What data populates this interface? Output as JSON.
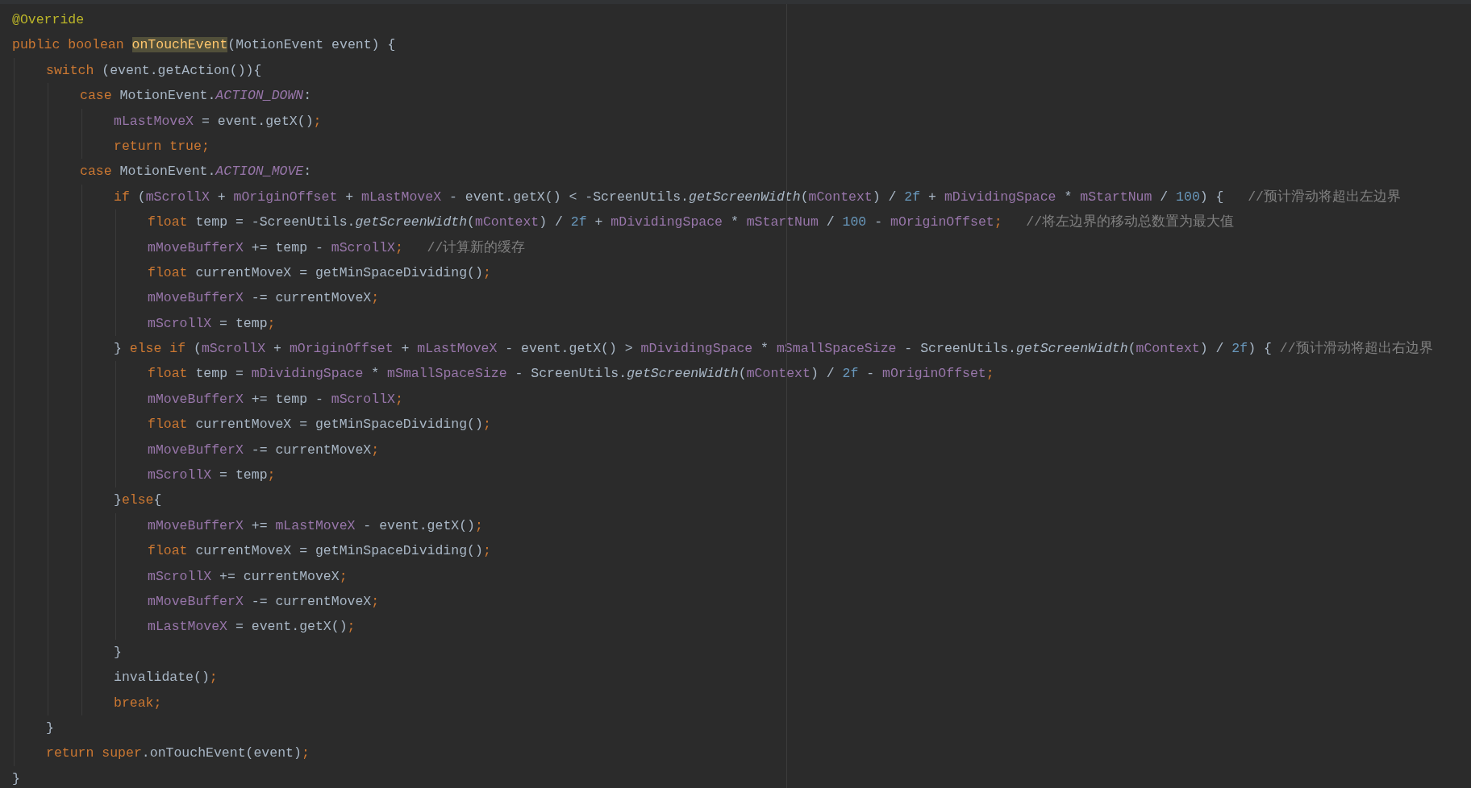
{
  "editor": {
    "lines": [
      {
        "tokens": [
          {
            "kind": "annotation",
            "text": "@Override"
          }
        ]
      },
      {
        "tokens": [
          {
            "kind": "keyword",
            "text": "public boolean "
          },
          {
            "kind": "declaration",
            "text": "onTouchEvent"
          },
          {
            "kind": "plain",
            "text": "(MotionEvent event) {"
          }
        ],
        "children": [
          {
            "tokens": [
              {
                "kind": "keyword",
                "text": "switch "
              },
              {
                "kind": "plain",
                "text": "(event.getAction()){"
              }
            ],
            "children": [
              {
                "tokens": [
                  {
                    "kind": "keyword",
                    "text": "case "
                  },
                  {
                    "kind": "plain",
                    "text": "MotionEvent."
                  },
                  {
                    "kind": "constant",
                    "text": "ACTION_DOWN"
                  },
                  {
                    "kind": "plain",
                    "text": ":"
                  }
                ],
                "children": [
                  {
                    "tokens": [
                      {
                        "kind": "field",
                        "text": "mLastMoveX"
                      },
                      {
                        "kind": "plain",
                        "text": " = event.getX()"
                      },
                      {
                        "kind": "keyword",
                        "text": ";"
                      }
                    ]
                  },
                  {
                    "tokens": [
                      {
                        "kind": "keyword",
                        "text": "return true;"
                      }
                    ]
                  }
                ]
              },
              {
                "tokens": [
                  {
                    "kind": "keyword",
                    "text": "case "
                  },
                  {
                    "kind": "plain",
                    "text": "MotionEvent."
                  },
                  {
                    "kind": "constant",
                    "text": "ACTION_MOVE"
                  },
                  {
                    "kind": "plain",
                    "text": ":"
                  }
                ],
                "children": [
                  {
                    "tokens": [
                      {
                        "kind": "keyword",
                        "text": "if "
                      },
                      {
                        "kind": "plain",
                        "text": "("
                      },
                      {
                        "kind": "field",
                        "text": "mScrollX"
                      },
                      {
                        "kind": "plain",
                        "text": " + "
                      },
                      {
                        "kind": "field",
                        "text": "mOriginOffset"
                      },
                      {
                        "kind": "plain",
                        "text": " + "
                      },
                      {
                        "kind": "field",
                        "text": "mLastMoveX"
                      },
                      {
                        "kind": "plain",
                        "text": " - event.getX() < -ScreenUtils."
                      },
                      {
                        "kind": "static_method",
                        "text": "getScreenWidth"
                      },
                      {
                        "kind": "plain",
                        "text": "("
                      },
                      {
                        "kind": "field",
                        "text": "mContext"
                      },
                      {
                        "kind": "plain",
                        "text": ") / "
                      },
                      {
                        "kind": "number",
                        "text": "2f"
                      },
                      {
                        "kind": "plain",
                        "text": " + "
                      },
                      {
                        "kind": "field",
                        "text": "mDividingSpace"
                      },
                      {
                        "kind": "plain",
                        "text": " * "
                      },
                      {
                        "kind": "field",
                        "text": "mStartNum"
                      },
                      {
                        "kind": "plain",
                        "text": " / "
                      },
                      {
                        "kind": "number",
                        "text": "100"
                      },
                      {
                        "kind": "plain",
                        "text": ") {   "
                      },
                      {
                        "kind": "comment",
                        "text": "//预计滑动将超出左边界"
                      }
                    ],
                    "children": [
                      {
                        "tokens": [
                          {
                            "kind": "keyword",
                            "text": "float "
                          },
                          {
                            "kind": "plain",
                            "text": "temp = -ScreenUtils."
                          },
                          {
                            "kind": "static_method",
                            "text": "getScreenWidth"
                          },
                          {
                            "kind": "plain",
                            "text": "("
                          },
                          {
                            "kind": "field",
                            "text": "mContext"
                          },
                          {
                            "kind": "plain",
                            "text": ") / "
                          },
                          {
                            "kind": "number",
                            "text": "2f"
                          },
                          {
                            "kind": "plain",
                            "text": " + "
                          },
                          {
                            "kind": "field",
                            "text": "mDividingSpace"
                          },
                          {
                            "kind": "plain",
                            "text": " * "
                          },
                          {
                            "kind": "field",
                            "text": "mStartNum"
                          },
                          {
                            "kind": "plain",
                            "text": " / "
                          },
                          {
                            "kind": "number",
                            "text": "100"
                          },
                          {
                            "kind": "plain",
                            "text": " - "
                          },
                          {
                            "kind": "field",
                            "text": "mOriginOffset"
                          },
                          {
                            "kind": "keyword",
                            "text": ";"
                          },
                          {
                            "kind": "comment",
                            "text": "   //将左边界的移动总数置为最大值"
                          }
                        ]
                      },
                      {
                        "tokens": [
                          {
                            "kind": "field",
                            "text": "mMoveBufferX"
                          },
                          {
                            "kind": "plain",
                            "text": " += temp - "
                          },
                          {
                            "kind": "field",
                            "text": "mScrollX"
                          },
                          {
                            "kind": "keyword",
                            "text": ";"
                          },
                          {
                            "kind": "comment",
                            "text": "   //计算新的缓存"
                          }
                        ]
                      },
                      {
                        "tokens": [
                          {
                            "kind": "keyword",
                            "text": "float "
                          },
                          {
                            "kind": "plain",
                            "text": "currentMoveX = getMinSpaceDividing()"
                          },
                          {
                            "kind": "keyword",
                            "text": ";"
                          }
                        ]
                      },
                      {
                        "tokens": [
                          {
                            "kind": "field",
                            "text": "mMoveBufferX"
                          },
                          {
                            "kind": "plain",
                            "text": " -= currentMoveX"
                          },
                          {
                            "kind": "keyword",
                            "text": ";"
                          }
                        ]
                      },
                      {
                        "tokens": [
                          {
                            "kind": "field",
                            "text": "mScrollX"
                          },
                          {
                            "kind": "plain",
                            "text": " = temp"
                          },
                          {
                            "kind": "keyword",
                            "text": ";"
                          }
                        ]
                      }
                    ]
                  },
                  {
                    "tokens": [
                      {
                        "kind": "plain",
                        "text": "} "
                      },
                      {
                        "kind": "keyword",
                        "text": "else if "
                      },
                      {
                        "kind": "plain",
                        "text": "("
                      },
                      {
                        "kind": "field",
                        "text": "mScrollX"
                      },
                      {
                        "kind": "plain",
                        "text": " + "
                      },
                      {
                        "kind": "field",
                        "text": "mOriginOffset"
                      },
                      {
                        "kind": "plain",
                        "text": " + "
                      },
                      {
                        "kind": "field",
                        "text": "mLastMoveX"
                      },
                      {
                        "kind": "plain",
                        "text": " - event.getX() > "
                      },
                      {
                        "kind": "field",
                        "text": "mDividingSpace"
                      },
                      {
                        "kind": "plain",
                        "text": " * "
                      },
                      {
                        "kind": "field",
                        "text": "mSmallSpaceSize"
                      },
                      {
                        "kind": "plain",
                        "text": " - ScreenUtils."
                      },
                      {
                        "kind": "static_method",
                        "text": "getScreenWidth"
                      },
                      {
                        "kind": "plain",
                        "text": "("
                      },
                      {
                        "kind": "field",
                        "text": "mContext"
                      },
                      {
                        "kind": "plain",
                        "text": ") / "
                      },
                      {
                        "kind": "number",
                        "text": "2f"
                      },
                      {
                        "kind": "plain",
                        "text": ") { "
                      },
                      {
                        "kind": "comment",
                        "text": "//预计滑动将超出右边界"
                      }
                    ],
                    "children": [
                      {
                        "tokens": [
                          {
                            "kind": "keyword",
                            "text": "float "
                          },
                          {
                            "kind": "plain",
                            "text": "temp = "
                          },
                          {
                            "kind": "field",
                            "text": "mDividingSpace"
                          },
                          {
                            "kind": "plain",
                            "text": " * "
                          },
                          {
                            "kind": "field",
                            "text": "mSmallSpaceSize"
                          },
                          {
                            "kind": "plain",
                            "text": " - ScreenUtils."
                          },
                          {
                            "kind": "static_method",
                            "text": "getScreenWidth"
                          },
                          {
                            "kind": "plain",
                            "text": "("
                          },
                          {
                            "kind": "field",
                            "text": "mContext"
                          },
                          {
                            "kind": "plain",
                            "text": ") / "
                          },
                          {
                            "kind": "number",
                            "text": "2f"
                          },
                          {
                            "kind": "plain",
                            "text": " - "
                          },
                          {
                            "kind": "field",
                            "text": "mOriginOffset"
                          },
                          {
                            "kind": "keyword",
                            "text": ";"
                          }
                        ]
                      },
                      {
                        "tokens": [
                          {
                            "kind": "field",
                            "text": "mMoveBufferX"
                          },
                          {
                            "kind": "plain",
                            "text": " += temp - "
                          },
                          {
                            "kind": "field",
                            "text": "mScrollX"
                          },
                          {
                            "kind": "keyword",
                            "text": ";"
                          }
                        ]
                      },
                      {
                        "tokens": [
                          {
                            "kind": "keyword",
                            "text": "float "
                          },
                          {
                            "kind": "plain",
                            "text": "currentMoveX = getMinSpaceDividing()"
                          },
                          {
                            "kind": "keyword",
                            "text": ";"
                          }
                        ]
                      },
                      {
                        "tokens": [
                          {
                            "kind": "field",
                            "text": "mMoveBufferX"
                          },
                          {
                            "kind": "plain",
                            "text": " -= currentMoveX"
                          },
                          {
                            "kind": "keyword",
                            "text": ";"
                          }
                        ]
                      },
                      {
                        "tokens": [
                          {
                            "kind": "field",
                            "text": "mScrollX"
                          },
                          {
                            "kind": "plain",
                            "text": " = temp"
                          },
                          {
                            "kind": "keyword",
                            "text": ";"
                          }
                        ]
                      }
                    ]
                  },
                  {
                    "tokens": [
                      {
                        "kind": "plain",
                        "text": "}"
                      },
                      {
                        "kind": "keyword",
                        "text": "else"
                      },
                      {
                        "kind": "plain",
                        "text": "{"
                      }
                    ],
                    "children": [
                      {
                        "tokens": [
                          {
                            "kind": "field",
                            "text": "mMoveBufferX"
                          },
                          {
                            "kind": "plain",
                            "text": " += "
                          },
                          {
                            "kind": "field",
                            "text": "mLastMoveX"
                          },
                          {
                            "kind": "plain",
                            "text": " - event.getX()"
                          },
                          {
                            "kind": "keyword",
                            "text": ";"
                          }
                        ]
                      },
                      {
                        "tokens": [
                          {
                            "kind": "keyword",
                            "text": "float "
                          },
                          {
                            "kind": "plain",
                            "text": "currentMoveX = getMinSpaceDividing()"
                          },
                          {
                            "kind": "keyword",
                            "text": ";"
                          }
                        ]
                      },
                      {
                        "tokens": [
                          {
                            "kind": "field",
                            "text": "mScrollX"
                          },
                          {
                            "kind": "plain",
                            "text": " += currentMoveX"
                          },
                          {
                            "kind": "keyword",
                            "text": ";"
                          }
                        ]
                      },
                      {
                        "tokens": [
                          {
                            "kind": "field",
                            "text": "mMoveBufferX"
                          },
                          {
                            "kind": "plain",
                            "text": " -= currentMoveX"
                          },
                          {
                            "kind": "keyword",
                            "text": ";"
                          }
                        ]
                      },
                      {
                        "tokens": [
                          {
                            "kind": "field",
                            "text": "mLastMoveX"
                          },
                          {
                            "kind": "plain",
                            "text": " = event.getX()"
                          },
                          {
                            "kind": "keyword",
                            "text": ";"
                          }
                        ]
                      }
                    ]
                  },
                  {
                    "tokens": [
                      {
                        "kind": "plain",
                        "text": "}"
                      }
                    ]
                  },
                  {
                    "tokens": [
                      {
                        "kind": "plain",
                        "text": "invalidate()"
                      },
                      {
                        "kind": "keyword",
                        "text": ";"
                      }
                    ]
                  },
                  {
                    "tokens": [
                      {
                        "kind": "keyword",
                        "text": "break"
                      },
                      {
                        "kind": "keyword",
                        "text": ";"
                      }
                    ]
                  }
                ]
              }
            ]
          },
          {
            "tokens": [
              {
                "kind": "plain",
                "text": "}"
              }
            ]
          },
          {
            "tokens": [
              {
                "kind": "keyword",
                "text": "return super"
              },
              {
                "kind": "plain",
                "text": ".onTouchEvent(event)"
              },
              {
                "kind": "keyword",
                "text": ";"
              }
            ]
          }
        ]
      },
      {
        "tokens": [
          {
            "kind": "plain",
            "text": "}"
          }
        ]
      }
    ]
  }
}
